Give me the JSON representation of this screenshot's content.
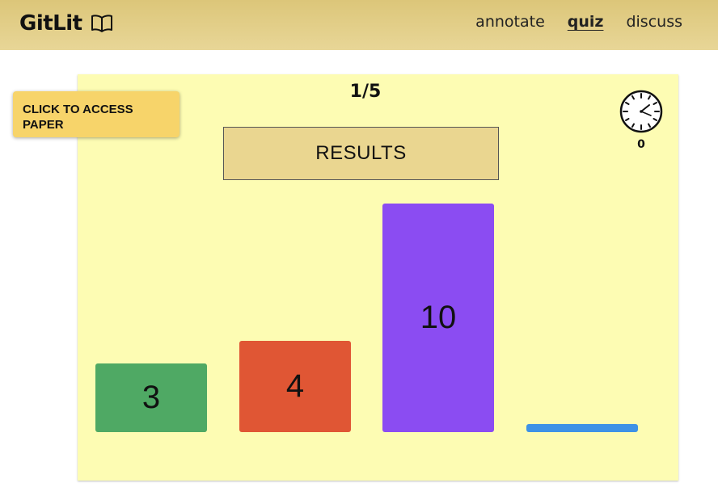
{
  "app": {
    "brand": "GitLit",
    "nav": [
      {
        "label": "annotate",
        "active": false
      },
      {
        "label": "quiz",
        "active": true
      },
      {
        "label": "discuss",
        "active": false
      }
    ]
  },
  "quiz": {
    "paper_button_label": "CLICK TO ACCESS PAPER",
    "counter": "1/5",
    "results_label": "RESULTS",
    "timer_value": "0"
  },
  "chart_data": {
    "type": "bar",
    "categories": [
      "",
      "",
      "",
      ""
    ],
    "series": [
      {
        "values": [
          3,
          4,
          10,
          0
        ]
      }
    ],
    "value_labels": [
      "3",
      "4",
      "10",
      ""
    ],
    "colors": [
      "#4fa964",
      "#e05634",
      "#8b4cf2",
      "#3e92e6"
    ]
  },
  "colors": {
    "header": "#e2cf86",
    "card": "#fdfcb3",
    "paper_button": "#f7d46a",
    "results_box": "#ead690"
  },
  "icons": {
    "brand": "open-book-icon",
    "timer": "clock-icon"
  }
}
